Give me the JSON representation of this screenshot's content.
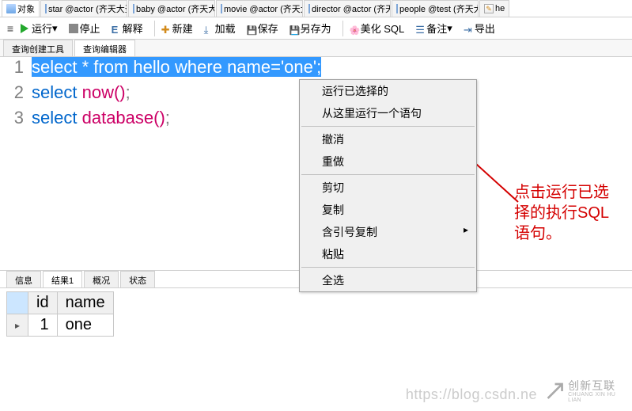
{
  "top_tabs": [
    {
      "label": "对象",
      "kind": "obj",
      "active": true
    },
    {
      "label": "star @actor (齐天大圣...",
      "kind": "table"
    },
    {
      "label": "baby @actor (齐天大...",
      "kind": "table"
    },
    {
      "label": "movie @actor (齐天大...",
      "kind": "table"
    },
    {
      "label": "director @actor (齐天...",
      "kind": "table"
    },
    {
      "label": "people @test (齐天大...",
      "kind": "table"
    },
    {
      "label": "he",
      "kind": "query"
    }
  ],
  "toolbar": {
    "menu": "≡",
    "run": "运行",
    "stop": "停止",
    "explain": "解释",
    "new": "新建",
    "load": "加载",
    "save": "保存",
    "saveas": "另存为",
    "beauty": "美化 SQL",
    "note": "备注",
    "export": "导出"
  },
  "sub_tabs": {
    "builder": "查询创建工具",
    "editor": "查询编辑器"
  },
  "editor_lines": {
    "l1_select": "select",
    "l1_star": " * ",
    "l1_from": "from",
    "l1_sp": " ",
    "l1_tbl": "hello",
    "l1_sp2": " ",
    "l1_where": "where",
    "l1_sp3": " ",
    "l1_col": "name",
    "l1_eq": "=",
    "l1_str": "'one'",
    "l1_sc": ";",
    "l2_select": "select",
    "l2_sp": " ",
    "l2_func": "now()",
    "l2_sc": ";",
    "l3_select": "select",
    "l3_sp": " ",
    "l3_func": "database()",
    "l3_sc": ";"
  },
  "line_numbers": {
    "l1": "1",
    "l2": "2",
    "l3": "3"
  },
  "context_menu": {
    "run_selected": "运行已选择的",
    "run_from_here": "从这里运行一个语句",
    "undo": "撤消",
    "redo": "重做",
    "cut": "剪切",
    "copy": "复制",
    "copy_quoted": "含引号复制",
    "paste": "粘贴",
    "select_all": "全选"
  },
  "annotation": "点击运行已选择的执行SQL语句。",
  "result_tabs": {
    "info": "信息",
    "result1": "结果1",
    "profile": "概况",
    "status": "状态"
  },
  "grid": {
    "col_id": "id",
    "col_name": "name",
    "row1_id": "1",
    "row1_name": "one",
    "marker": "▸"
  },
  "footer": {
    "url": "https://blog.csdn.ne",
    "logo_big": "创新互联",
    "logo_small": "CHUANG XIN HU LIAN"
  }
}
